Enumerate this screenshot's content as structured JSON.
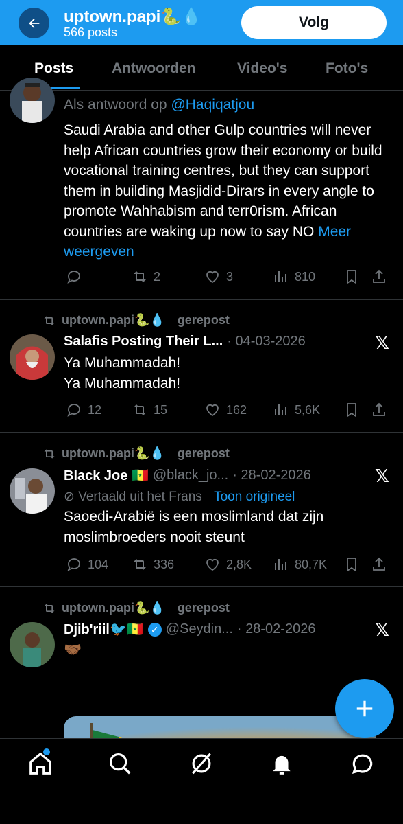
{
  "header": {
    "back_icon": "arrow-left-icon",
    "profile_name": "uptown.papi🐍💧",
    "post_count": "566 posts",
    "follow_label": "Volg"
  },
  "tabs": [
    {
      "label": "Posts",
      "active": true
    },
    {
      "label": "Antwoorden",
      "active": false
    },
    {
      "label": "Video's",
      "active": false
    },
    {
      "label": "Foto's",
      "active": false
    }
  ],
  "tweets": [
    {
      "reply_prefix": "Als antwoord op ",
      "reply_to": "@Haqiqatjou",
      "text": "Saudi Arabia and other Gulp countries will never help African countries grow their economy or build vocational training centres, but they can support them in building Masjidid-Dirars in every angle to promote Wahhabism and terr0rism. African countries are waking up now to say NO",
      "show_more": "Meer weergeven",
      "replies": "",
      "reposts": "2",
      "likes": "3",
      "views": "810"
    },
    {
      "reposted_by": "uptown.papi🐍💧",
      "repost_label": "gerepost",
      "author": "Salafis Posting Their L...",
      "date": "· 04-03-2026",
      "line1": "Ya Muhammadah!",
      "line2": "Ya Muhammadah!",
      "replies": "12",
      "reposts": "15",
      "likes": "162",
      "views": "5,6K"
    },
    {
      "reposted_by": "uptown.papi🐍💧",
      "repost_label": "gerepost",
      "author": "Black Joe 🇸🇳",
      "handle": "@black_jo...",
      "date": "· 28-02-2026",
      "translated_label": "Vertaald uit het Frans",
      "show_original": "Toon origineel",
      "text": "Saoedi-Arabië is een moslimland dat zijn moslimbroeders nooit steunt",
      "replies": "104",
      "reposts": "336",
      "likes": "2,8K",
      "views": "80,7K"
    },
    {
      "reposted_by": "uptown.papi🐍💧",
      "repost_label": "gerepost",
      "author": "Djib'riil🐦🇸🇳",
      "handle": "@Seydin...",
      "date": "· 28-02-2026",
      "text": "🤝🏾"
    }
  ],
  "x_logo": "𝕏",
  "colors": {
    "accent": "#1d9bf0",
    "muted": "#71767b",
    "background": "#000000",
    "divider": "#2f3336"
  },
  "nav_icons": [
    "home-icon",
    "search-icon",
    "grok-icon",
    "notifications-icon",
    "messages-icon"
  ]
}
